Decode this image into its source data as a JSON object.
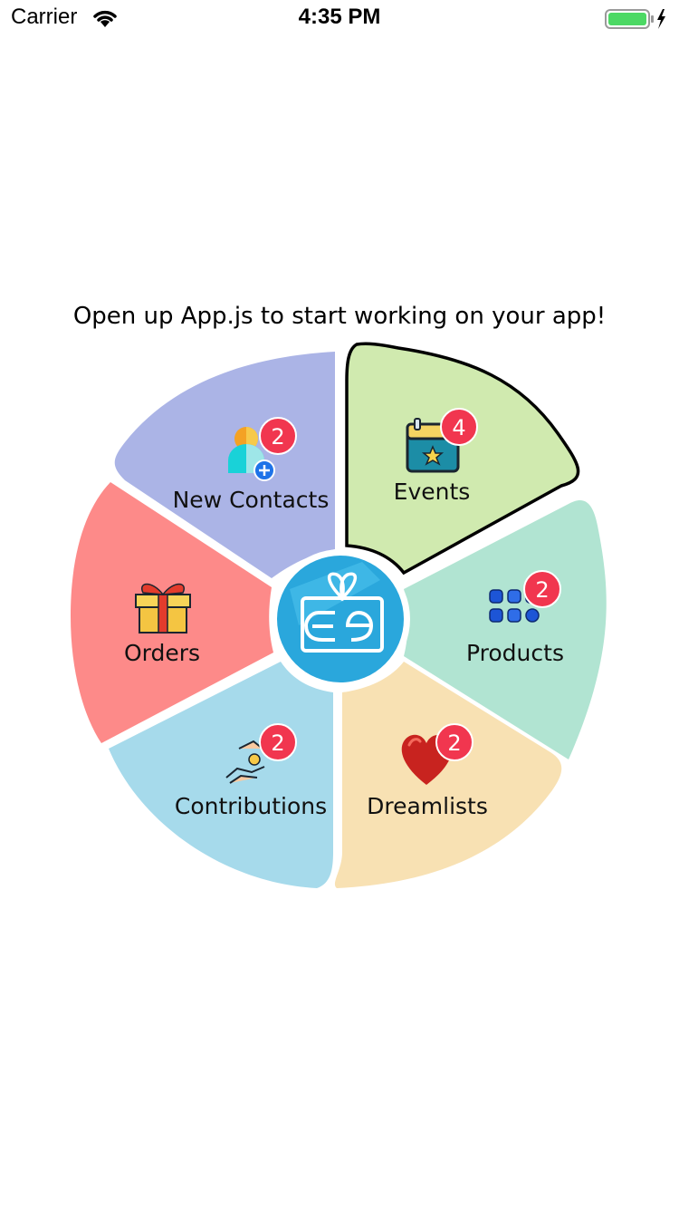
{
  "status_bar": {
    "carrier": "Carrier",
    "time": "4:35 PM",
    "battery_color": "#4cd964"
  },
  "instructions": "Open up App.js to start working on your app!",
  "menu": {
    "segments": [
      {
        "id": "new-contacts",
        "label": "New Contacts",
        "badge": "2",
        "color": "#abb4e6",
        "icon": "add-contact-icon"
      },
      {
        "id": "events",
        "label": "Events",
        "badge": "4",
        "color": "#d0eaaf",
        "icon": "calendar-star-icon",
        "selected": true
      },
      {
        "id": "products",
        "label": "Products",
        "badge": "2",
        "color": "#b1e4d2",
        "icon": "products-grid-icon"
      },
      {
        "id": "dreamlists",
        "label": "Dreamlists",
        "badge": "2",
        "color": "#f8e1b3",
        "icon": "heart-icon"
      },
      {
        "id": "contributions",
        "label": "Contributions",
        "badge": "2",
        "color": "#a6daeb",
        "icon": "giving-hands-coin-icon"
      },
      {
        "id": "orders",
        "label": "Orders",
        "badge": "",
        "color": "#fd8a89",
        "icon": "gift-box-icon"
      }
    ],
    "center_logo": "gift-logo-icon",
    "badge_color": "#f1364f"
  }
}
